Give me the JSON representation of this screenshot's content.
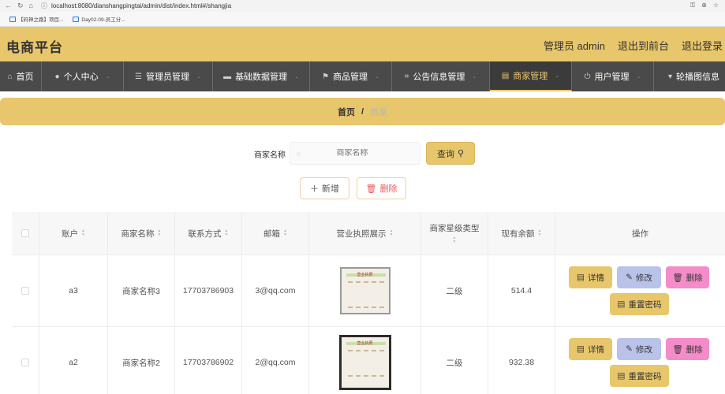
{
  "browser": {
    "url": "localhost:8080/dianshangpingtai/admin/dist/index.html#/shangjia",
    "bookmarks": [
      "【码神之路】项目...",
      "Day02-09-员工分..."
    ]
  },
  "header": {
    "title": "电商平台",
    "links": [
      "管理员 admin",
      "退出到前台",
      "退出登录"
    ]
  },
  "nav": {
    "items": [
      {
        "label": "首页",
        "icon": "home-icon"
      },
      {
        "label": "个人中心",
        "icon": "user-icon"
      },
      {
        "label": "管理员管理",
        "icon": "sliders-icon"
      },
      {
        "label": "基础数据管理",
        "icon": "briefcase-icon"
      },
      {
        "label": "商品管理",
        "icon": "flag-icon"
      },
      {
        "label": "公告信息管理",
        "icon": "crop-icon"
      },
      {
        "label": "商家管理",
        "icon": "calendar-icon"
      },
      {
        "label": "用户管理",
        "icon": "power-icon"
      },
      {
        "label": "轮播图信息",
        "icon": "pin-icon"
      }
    ],
    "active": "商家管理"
  },
  "breadcrumb": {
    "home": "首页",
    "separator": "/",
    "current": "商家"
  },
  "search": {
    "label": "商家名称",
    "placeholder": "商家名称",
    "button": "查询"
  },
  "actions": {
    "add": "新增",
    "delete": "删除"
  },
  "table": {
    "columns": [
      "账户",
      "商家名称",
      "联系方式",
      "邮箱",
      "营业执照展示",
      "商家星级类型",
      "现有余额",
      "操作"
    ],
    "rows": [
      {
        "account": "a3",
        "name": "商家名称3",
        "phone": "17703786903",
        "email": "3@qq.com",
        "license_title": "营业执照",
        "level": "二级",
        "balance": "514.4"
      },
      {
        "account": "a2",
        "name": "商家名称2",
        "phone": "17703786902",
        "email": "2@qq.com",
        "license_title": "营业执照",
        "level": "二级",
        "balance": "932.38"
      }
    ],
    "row_actions": {
      "detail": "详情",
      "edit": "修改",
      "remove": "删除",
      "reset": "重置密码"
    }
  },
  "colors": {
    "accent": "#e8c66b",
    "nav_bg": "#4a4a4a",
    "edit": "#b9c3ea",
    "remove": "#f38cc8",
    "danger": "#e85a5a"
  }
}
